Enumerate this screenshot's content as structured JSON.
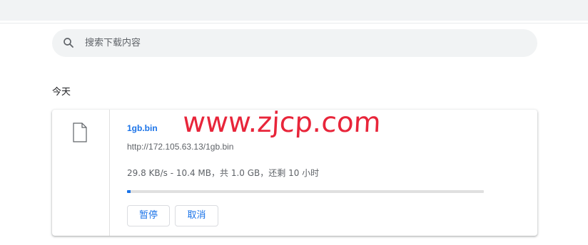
{
  "search": {
    "placeholder": "搜索下载内容",
    "icon": "search-icon"
  },
  "section": {
    "title": "今天"
  },
  "download": {
    "file_icon": "file-icon",
    "file_name": "1gb.bin",
    "url": "http://172.105.63.13/1gb.bin",
    "status": "29.8 KB/s - 10.4 MB，共 1.0 GB，还剩 10 小时",
    "progress_fraction": 0.0104,
    "pause_label": "暂停",
    "cancel_label": "取消"
  },
  "watermark": {
    "text": "www.zjcp.com"
  },
  "colors": {
    "accent": "#1a73e8",
    "watermark": "#e8253a",
    "search_bg": "#f1f3f4"
  }
}
